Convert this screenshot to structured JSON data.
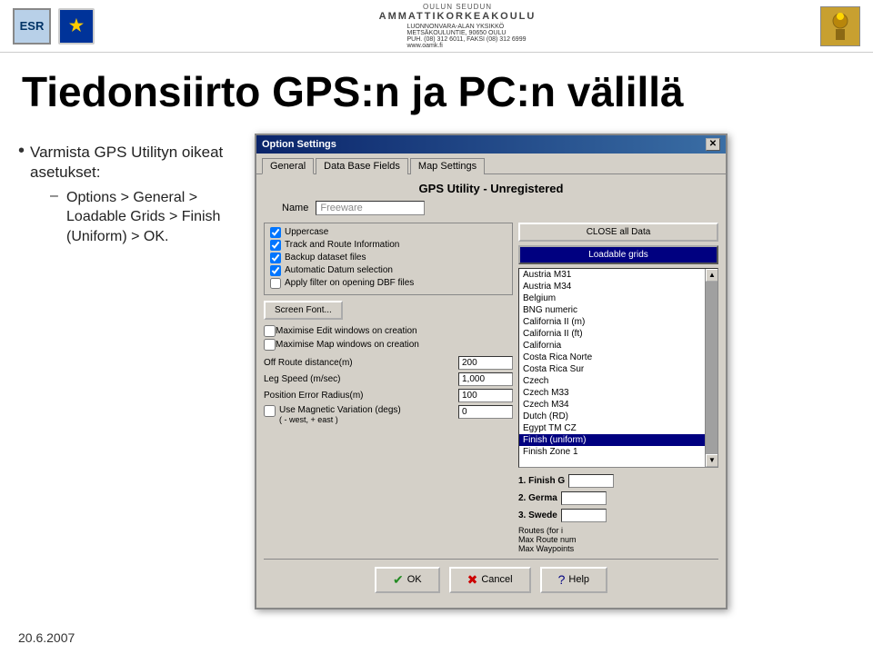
{
  "header": {
    "logo_esr": "ESR",
    "logo_eu": "★",
    "oamk_top": "OULUN SEUDUN",
    "oamk_main": "AMMATTIKORKEAKOULU",
    "org_name": "LUONNONVARA-ALAN YKSIKKÖ",
    "org_addr1": "METSÄKOULUNTIE, 90650 OULU",
    "org_phone": "PUH. (08) 312 6011, FAKSI (08) 312 6999",
    "org_web": "www.oamk.fi"
  },
  "title": "Tiedonsiirto GPS:n ja PC:n välillä",
  "bullets": [
    {
      "text": "Varmista GPS Utilityn oikeat asetukset:",
      "sub": [
        "Options > General > Loadable Grids > Finish (Uniform) > OK."
      ]
    }
  ],
  "dialog": {
    "title": "Option Settings",
    "close_btn": "✕",
    "tabs": [
      "General",
      "Data Base Fields",
      "Map Settings"
    ],
    "active_tab": "General",
    "gps_title": "GPS Utility - Unregistered",
    "name_label": "Name",
    "name_value": "Freeware",
    "checkboxes": [
      {
        "label": "Uppercase",
        "checked": true
      },
      {
        "label": "Track and Route Information",
        "checked": true
      },
      {
        "label": "Backup dataset files",
        "checked": true
      },
      {
        "label": "Automatic Datum selection",
        "checked": true
      },
      {
        "label": "Apply filter on opening DBF files",
        "checked": false
      }
    ],
    "screen_font_btn": "Screen Font...",
    "checkboxes2": [
      {
        "label": "Maximise Edit windows on creation",
        "checked": false
      },
      {
        "label": "Maximise Map windows on creation",
        "checked": false
      }
    ],
    "fields": [
      {
        "label": "Off Route distance(m)",
        "value": "200"
      },
      {
        "label": "Leg Speed (m/sec)",
        "value": "1,000"
      },
      {
        "label": "Position Error Radius(m)",
        "value": "100"
      }
    ],
    "mag_var": {
      "label": "Use Magnetic Variation (degs)",
      "sub": "( - west, + east )",
      "value": "0"
    },
    "close_all_label": "CLOSE all Data",
    "loadable_btn": "Loadable grids",
    "list_items": [
      {
        "label": "Austria M31",
        "selected": false
      },
      {
        "label": "Austria M34",
        "selected": false
      },
      {
        "label": "Belgium",
        "selected": false
      },
      {
        "label": "BNG numeric",
        "selected": false
      },
      {
        "label": "California II (m)",
        "selected": false
      },
      {
        "label": "California II (ft)",
        "selected": false
      },
      {
        "label": "California",
        "selected": false
      },
      {
        "label": "Costa Rica Norte",
        "selected": false
      },
      {
        "label": "Costa Rica Sur",
        "selected": false
      },
      {
        "label": "Czech",
        "selected": false
      },
      {
        "label": "Czech M33",
        "selected": false
      },
      {
        "label": "Czech M34",
        "selected": false
      },
      {
        "label": "Dutch (RD)",
        "selected": false
      },
      {
        "label": "Egypt TM CZ",
        "selected": false
      },
      {
        "label": "Finish (uniform)",
        "selected": true
      },
      {
        "label": "Finish Zone 1",
        "selected": false
      }
    ],
    "numbered": [
      {
        "num": "1.",
        "label": "Finish G",
        "input": ""
      },
      {
        "num": "2.",
        "label": "Germa",
        "input": ""
      },
      {
        "num": "3.",
        "label": "Swede",
        "input": ""
      }
    ],
    "routes_label": "Routes (for i",
    "max_route_label": "Max Route num",
    "max_waypoints_label": "Max Waypoints",
    "footer_buttons": [
      {
        "label": "OK",
        "icon": "✔",
        "icon_class": "ok-icon"
      },
      {
        "label": "Cancel",
        "icon": "✖",
        "icon_class": "cancel-icon"
      },
      {
        "label": "Help",
        "icon": "?",
        "icon_class": "help-icon"
      }
    ]
  },
  "footer": {
    "date": "20.6.2007"
  }
}
